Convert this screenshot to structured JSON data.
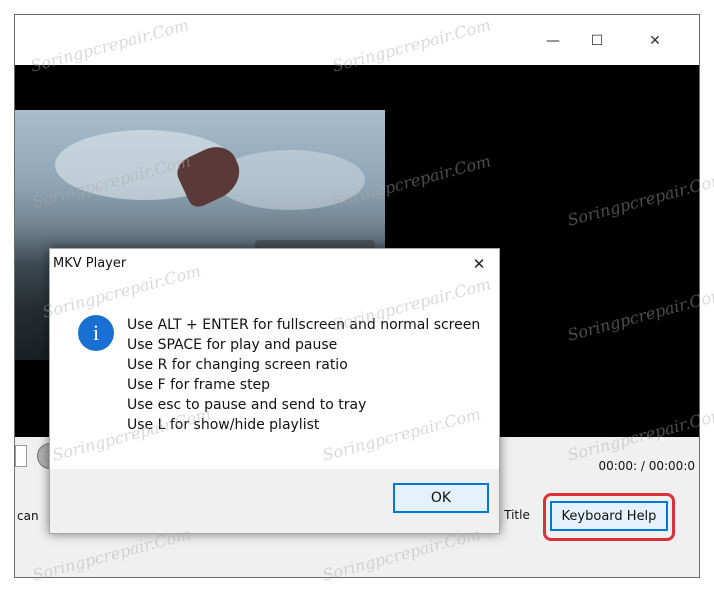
{
  "window": {
    "controls": {
      "minimize": "—",
      "maximize": "☐",
      "close": "✕"
    }
  },
  "controls": {
    "time_readout": "00:00: / 00:00:0"
  },
  "bottom_bar": {
    "left_label": "can",
    "title_label": "Title",
    "keyboard_help_label": "Keyboard Help"
  },
  "dialog": {
    "title": "MKV Player",
    "close_glyph": "✕",
    "info_glyph": "i",
    "lines": [
      "Use ALT + ENTER for fullscreen and normal screen",
      "Use SPACE for play and pause",
      "Use R for changing screen ratio",
      "Use F for frame step",
      "Use esc to pause and send to tray",
      "Use L for show/hide playlist"
    ],
    "ok_label": "OK"
  },
  "watermark": "Soringpcrepair.Com",
  "colors": {
    "accent": "#0078d7",
    "highlight": "#d9323b",
    "info": "#1a6fd3"
  }
}
